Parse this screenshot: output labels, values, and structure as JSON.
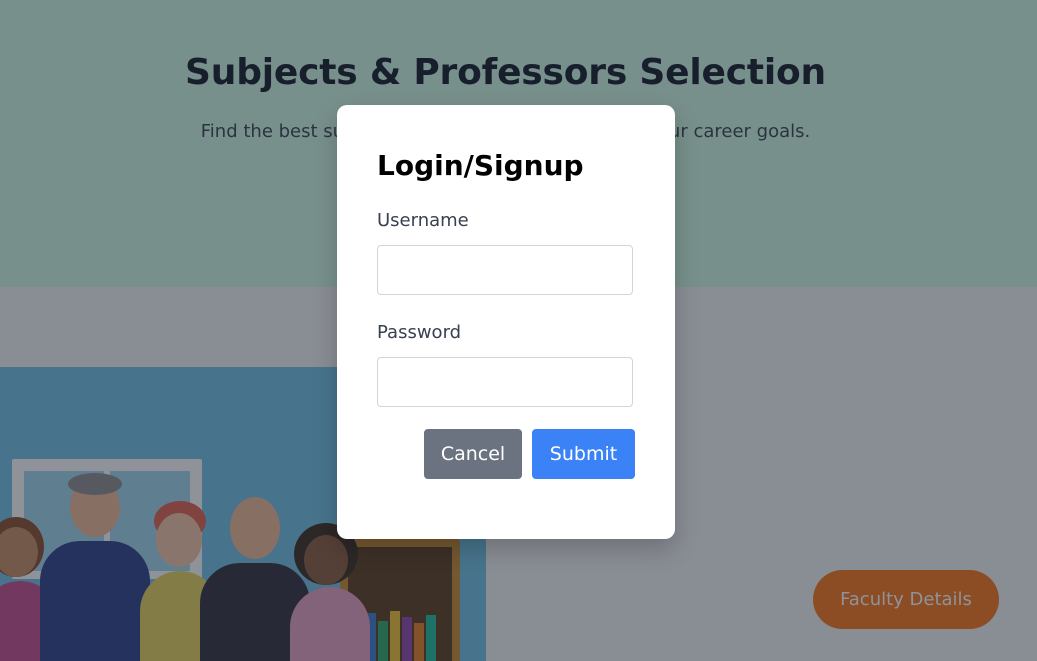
{
  "page": {
    "title": "Subjects & Professors Selection",
    "subtitle": "Find the best subjects and professors that match your career goals."
  },
  "faculty_button": {
    "label": "Faculty Details"
  },
  "modal": {
    "title": "Login/Signup",
    "username_label": "Username",
    "username_value": "",
    "password_label": "Password",
    "password_value": "",
    "cancel_label": "Cancel",
    "submit_label": "Submit"
  },
  "illustration": {
    "alt": "group of professors"
  },
  "colors": {
    "hero_bg": "#d1fae5",
    "accent_orange": "#f97316",
    "submit_blue": "#3b82f6",
    "cancel_gray": "#6b7280"
  }
}
